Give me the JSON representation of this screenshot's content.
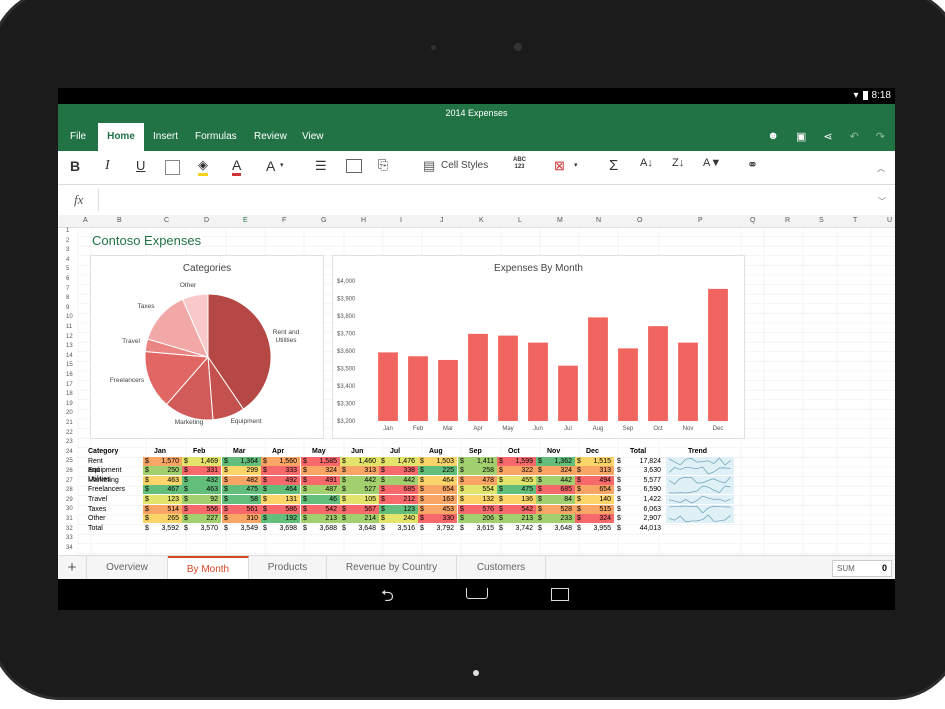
{
  "status": {
    "time": "8:18"
  },
  "window": {
    "title": "2014 Expenses"
  },
  "menu": {
    "tabs": [
      "File",
      "Home",
      "Insert",
      "Formulas",
      "Review",
      "View"
    ],
    "active": "Home"
  },
  "ribbon": {
    "bold": "B",
    "italic": "I",
    "underline": "U",
    "font_color_glyph": "A",
    "font_size_glyph": "A",
    "cell_styles": "Cell Styles",
    "abc_top": "ABC",
    "abc_bottom": "123",
    "sum_glyph": "Σ"
  },
  "formula": {
    "fx": "fx",
    "value": ""
  },
  "columns": [
    "A",
    "B",
    "C",
    "D",
    "E",
    "F",
    "G",
    "H",
    "I",
    "J",
    "K",
    "L",
    "M",
    "N",
    "O",
    "P",
    "Q",
    "R",
    "S",
    "T",
    "U"
  ],
  "rows": [
    "1",
    "2",
    "3",
    "4",
    "5",
    "6",
    "7",
    "8",
    "9",
    "10",
    "11",
    "12",
    "13",
    "14",
    "15",
    "16",
    "17",
    "18",
    "19",
    "20",
    "21",
    "22",
    "23",
    "24",
    "25",
    "26",
    "27",
    "28",
    "29",
    "30",
    "31",
    "32",
    "33",
    "34"
  ],
  "sheet_title": "Contoso Expenses",
  "chart_data": [
    {
      "type": "pie",
      "title": "Categories",
      "categories": [
        "Rent and Utilities",
        "Equipment",
        "Marketing",
        "Freelancers",
        "Travel",
        "Taxes",
        "Other"
      ],
      "values": [
        17824,
        3630,
        5577,
        6590,
        1422,
        6063,
        2907
      ],
      "colors": [
        "#b54744",
        "#c4514e",
        "#d05b58",
        "#e06764",
        "#eb8583",
        "#f2a8a6",
        "#f8c9c8"
      ]
    },
    {
      "type": "bar",
      "title": "Expenses By Month",
      "categories": [
        "Jan",
        "Feb",
        "Mar",
        "Apr",
        "May",
        "Jun",
        "Jul",
        "Aug",
        "Sep",
        "Oct",
        "Nov",
        "Dec"
      ],
      "values": [
        3592,
        3570,
        3549,
        3698,
        3688,
        3648,
        3516,
        3792,
        3615,
        3742,
        3648,
        3955
      ],
      "ylim": [
        3200,
        4000
      ],
      "yticks": [
        "$3,200",
        "$3,300",
        "$3,400",
        "$3,500",
        "$3,600",
        "$3,700",
        "$3,800",
        "$3,900",
        "$4,000"
      ],
      "color": "#f0655f"
    }
  ],
  "table": {
    "headers": [
      "Category",
      "Jan",
      "Feb",
      "Mar",
      "Apr",
      "May",
      "Jun",
      "Jul",
      "Aug",
      "Sep",
      "Oct",
      "Nov",
      "Dec",
      "Total",
      "Trend"
    ],
    "currency": "$",
    "rows": [
      {
        "label": "Rent and Utilities",
        "values": [
          "1,570",
          "1,469",
          "1,364",
          "1,560",
          "1,585",
          "1,460",
          "1,476",
          "1,503",
          "1,411",
          "1,599",
          "1,362",
          "1,515"
        ],
        "total": "17,824"
      },
      {
        "label": "Equipment",
        "values": [
          "250",
          "331",
          "299",
          "333",
          "324",
          "313",
          "338",
          "225",
          "258",
          "322",
          "324",
          "313"
        ],
        "total": "3,630"
      },
      {
        "label": "Marketing",
        "values": [
          "463",
          "432",
          "482",
          "492",
          "491",
          "442",
          "442",
          "464",
          "478",
          "455",
          "442",
          "494"
        ],
        "total": "5,577"
      },
      {
        "label": "Freelancers",
        "values": [
          "467",
          "463",
          "475",
          "464",
          "487",
          "527",
          "685",
          "654",
          "554",
          "475",
          "685",
          "654"
        ],
        "total": "6,590"
      },
      {
        "label": "Travel",
        "values": [
          "123",
          "92",
          "58",
          "131",
          "46",
          "105",
          "212",
          "163",
          "132",
          "136",
          "84",
          "140"
        ],
        "total": "1,422"
      },
      {
        "label": "Taxes",
        "values": [
          "514",
          "556",
          "561",
          "586",
          "542",
          "567",
          "123",
          "453",
          "576",
          "542",
          "528",
          "515"
        ],
        "total": "6,063"
      },
      {
        "label": "Other",
        "values": [
          "265",
          "227",
          "310",
          "192",
          "213",
          "214",
          "240",
          "330",
          "206",
          "213",
          "233",
          "324"
        ],
        "total": "2,907"
      },
      {
        "label": "Total",
        "values": [
          "3,592",
          "3,570",
          "3,549",
          "3,698",
          "3,688",
          "3,648",
          "3,516",
          "3,792",
          "3,615",
          "3,742",
          "3,648",
          "3,955"
        ],
        "total": "44,013"
      }
    ]
  },
  "sheets": {
    "add": "+",
    "tabs": [
      "Overview",
      "By Month",
      "Products",
      "Revenue by Country",
      "Customers"
    ],
    "active": "By Month"
  },
  "sum": {
    "label": "SUM",
    "value": "0"
  }
}
